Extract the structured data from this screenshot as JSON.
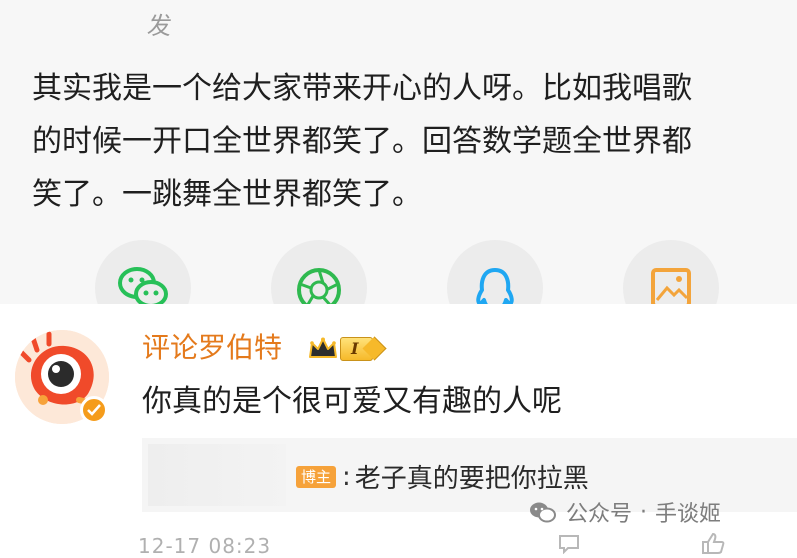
{
  "post": {
    "partial_label": "发",
    "body": "其实我是一个给大家带来开心的人呀。比如我唱歌\n的时候一开口全世界都笑了。回答数学题全世界都\n笑了。一跳舞全世界都笑了。",
    "share_buttons": [
      {
        "icon": "wechat-icon",
        "color": "#27c058"
      },
      {
        "icon": "moments-icon",
        "color": "#2fb94f"
      },
      {
        "icon": "qq-icon",
        "color": "#1fa7f2"
      },
      {
        "icon": "save-image-icon",
        "color": "#f3a43b"
      }
    ]
  },
  "comment": {
    "username": "评论罗伯特",
    "level": "I",
    "text": "你真的是个很可爱又有趣的人呢",
    "reply": {
      "tag": "博主",
      "separator": ":",
      "text": "老子真的要把你拉黑"
    },
    "timestamp": "12-17 08:23"
  },
  "watermark": {
    "part1": "公众号",
    "dot": "·",
    "part2": "手谈姬"
  },
  "colors": {
    "username": "#e47a1c",
    "badge": "#f6b92a",
    "blogger_tag": "#f6a23a"
  }
}
